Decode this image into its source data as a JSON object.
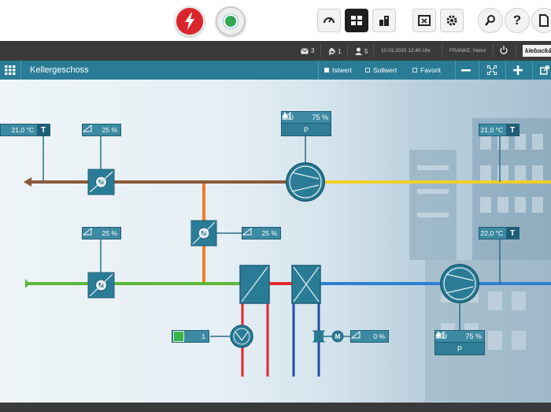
{
  "toolbar": {
    "buttons": [
      "alarm-button",
      "ok-status-button",
      "gauge-button",
      "schematic-button",
      "building-button",
      "screen-button",
      "settings-button",
      "search-button",
      "help-button",
      "document-button"
    ],
    "help_label": "?"
  },
  "statusbar": {
    "messages": "3",
    "hand": "1",
    "users": "5",
    "datetime": "10.03.2015  12:45 Uhr",
    "user": "FRANKE, Heinz",
    "brand": "kieback&peter"
  },
  "titlebar": {
    "title": "Kellergeschoss",
    "options": [
      {
        "label": "Istwert",
        "checked": true
      },
      {
        "label": "Sollwert",
        "checked": false
      },
      {
        "label": "Favorit",
        "checked": false
      }
    ]
  },
  "schematic": {
    "temp_left": "21,0 °C",
    "temp_right_top": "21,0 °C",
    "temp_right_supply": "22,0 °C",
    "temp_tag": "T",
    "damper_exhaust": "25 %",
    "damper_outdoor": "25 %",
    "damper_recirc": "25 %",
    "fan_exhaust": {
      "fu": "FU",
      "pct": "75 %",
      "p": "P"
    },
    "fan_supply": {
      "fu": "FU",
      "pct": "75 %",
      "p": "P"
    },
    "pump_state": "1",
    "valve": "0 %",
    "motor_letter": "M"
  },
  "colors": {
    "teal": "#2a7c96",
    "exhaust_duct": "#8b5a3a",
    "extract_duct": "#f0cf2a",
    "outdoor_duct": "#5cb83a",
    "supply_duct": "#2f7fd0",
    "recirc_duct": "#f07a2a",
    "hot_water": "#e0282b",
    "cold_water": "#1f4fa8"
  }
}
